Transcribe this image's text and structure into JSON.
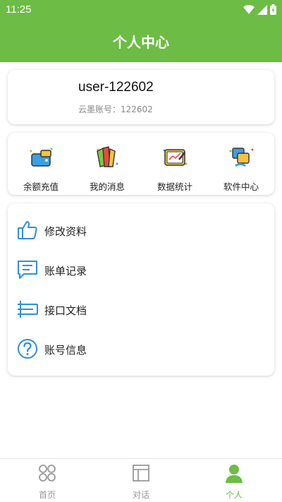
{
  "status_bar": {
    "time": "11:25"
  },
  "header": {
    "title": "个人中心"
  },
  "user": {
    "name": "user-122602",
    "account_label": "云墨账号：122602"
  },
  "quick_actions": [
    {
      "label": "余额充值",
      "icon": "wallet-icon"
    },
    {
      "label": "我的消息",
      "icon": "message-icon"
    },
    {
      "label": "数据统计",
      "icon": "statistics-icon"
    },
    {
      "label": "软件中心",
      "icon": "software-icon"
    }
  ],
  "menu": [
    {
      "label": "修改资料",
      "icon": "thumbs-up-icon"
    },
    {
      "label": "账单记录",
      "icon": "chat-list-icon"
    },
    {
      "label": "接口文档",
      "icon": "document-icon"
    },
    {
      "label": "账号信息",
      "icon": "question-icon"
    }
  ],
  "tabs": [
    {
      "label": "首页",
      "icon": "home-grid-icon",
      "active": false
    },
    {
      "label": "对话",
      "icon": "layout-icon",
      "active": false
    },
    {
      "label": "个人",
      "icon": "person-icon",
      "active": true
    }
  ],
  "colors": {
    "primary": "#6cbc45",
    "icon_blue": "#2f8fdc",
    "inactive": "#999999"
  }
}
